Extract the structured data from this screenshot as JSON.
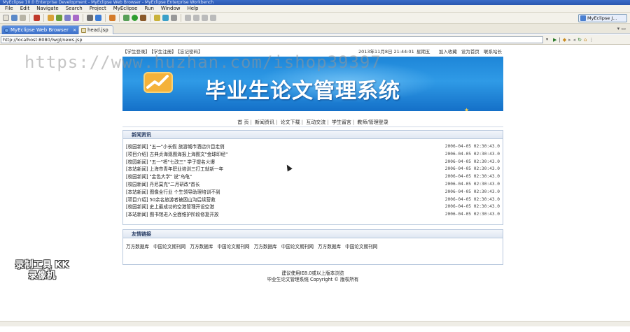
{
  "window": {
    "title": "MyEclipse 10.0 Enterprise Development - MyEclipse Web Browser - MyEclipse Enterprise Workbench"
  },
  "menu": [
    "File",
    "Edit",
    "Navigate",
    "Search",
    "Project",
    "MyEclipse",
    "Run",
    "Window",
    "Help"
  ],
  "perspective": {
    "label": "MyEclipse J..."
  },
  "tabs": [
    {
      "label": "MyEclipse Web Browser",
      "active": true
    },
    {
      "label": "head.jsp",
      "active": false
    }
  ],
  "tab_overflow": "▾ ▭",
  "address": {
    "url": "http://localhost:8080/lwgl/news.jsp",
    "drop": "▾"
  },
  "site": {
    "topbar": {
      "left": [
        "【学生登录】",
        "【学生注册】",
        "【忘记密码】"
      ],
      "date": "2013年11月8日 21:44:01",
      "weekday": "星期五",
      "links": [
        "加入收藏",
        "设为首页",
        "联系站长"
      ]
    },
    "banner": {
      "title": "毕业生论文管理系统"
    },
    "nav": [
      "首 页",
      "新闻资讯",
      "论文下载",
      "互动交流",
      "学生留言",
      "教师/管理登录"
    ],
    "news": {
      "title": "新闻资讯",
      "items": [
        {
          "text": "[校园新闻]  \"五一\"小长假 旅游城市酒店价目走俏",
          "date": "2006-04-05 02:30:43.0"
        },
        {
          "text": "[项目介绍]  古典贞海观图海报上海图文\"金球印经\"",
          "date": "2006-04-05 02:30:43.0"
        },
        {
          "text": "[校园新闻]  \"五一\"将\"七改三\"  学子提名火爆",
          "date": "2006-04-05 02:30:43.0"
        },
        {
          "text": "[本站新闻]  上海市青年职业培训三打工就新一年",
          "date": "2006-04-05 02:30:43.0"
        },
        {
          "text": "[校园新闻]  \"金色大学\" 说\"乌龟\"",
          "date": "2006-04-05 02:30:43.0"
        },
        {
          "text": "[校园新闻]  丹尼莫克\"二月研改\"首长",
          "date": "2006-04-05 02:30:43.0"
        },
        {
          "text": "[本站新闻]  图像全行业 个生领导助理培训不到",
          "date": "2006-04-05 02:30:43.0"
        },
        {
          "text": "[项目介绍]  50余名旅游者被困山沟后续营救",
          "date": "2006-04-05 02:30:43.0"
        },
        {
          "text": "[校园新闻]  史上最成功的空港管理开设空港",
          "date": "2006-04-05 02:30:43.0"
        },
        {
          "text": "[本站新闻]  图书馆进入全面维护阶段修复开放",
          "date": "2006-04-05 02:30:43.0"
        }
      ]
    },
    "friend_links": {
      "title": "友情链接",
      "items": [
        "万方数据库",
        "中国论文期刊网",
        "万方数据库",
        "中国论文期刊网",
        "万方数据库",
        "中国论文期刊网",
        "万方数据库",
        "中国论文期刊网"
      ]
    },
    "footer": {
      "line1": "建议使用IE8.0或以上版本浏览",
      "line2": "毕业生论文管理系统  Copyright © 版权所有"
    }
  },
  "overlay": {
    "watermark": "https://www.huzhan.com/ishop39397",
    "recorder": "录制工具 KK录像机"
  }
}
